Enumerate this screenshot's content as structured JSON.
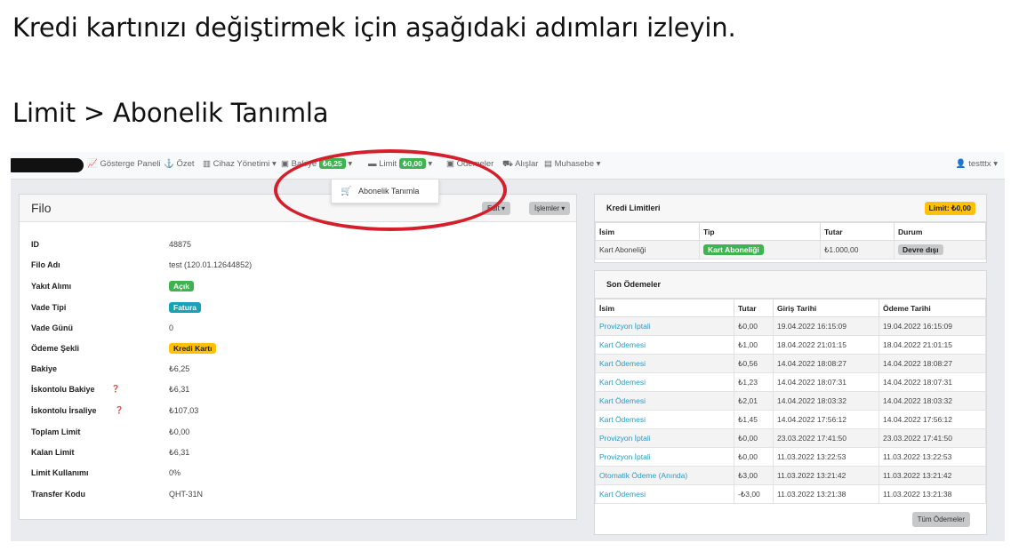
{
  "instructions": {
    "line1": "Kredi kartınızı değiştirmek için aşağıdaki adımları izleyin.",
    "line2": "Limit > Abonelik Tanımla"
  },
  "topbar": {
    "nav": {
      "gosterge": "Gösterge Paneli",
      "ozet": "Özet",
      "cihaz": "Cihaz Yönetimi",
      "bakiye": "Bakiye",
      "bakiye_badge": "₺6,25",
      "limit": "Limit",
      "limit_badge": "₺0,00",
      "odemeler": "Ödemeler",
      "alislar": "Alışlar",
      "muhasebe": "Muhasebe"
    },
    "user": "testttx"
  },
  "dropdown": {
    "item": "Abonelik Tanımla"
  },
  "filo": {
    "title": "Filo",
    "edit_button": "Edit",
    "islemler_button": "İşlemler",
    "rows": [
      {
        "label": "ID",
        "value": "48875"
      },
      {
        "label": "Filo Adı",
        "value": "test (120.01.12644852)"
      },
      {
        "label": "Yakıt Alımı",
        "value": "Açık"
      },
      {
        "label": "Vade Tipi",
        "value": "Fatura"
      },
      {
        "label": "Vade Günü",
        "value": "0"
      },
      {
        "label": "Ödeme Şekli",
        "value": "Kredi Kartı"
      },
      {
        "label": "Bakiye",
        "value": "₺6,25"
      },
      {
        "label": "İskontolu Bakiye",
        "value": "₺6,31"
      },
      {
        "label": "İskontolu İrsaliye",
        "value": "₺107,03"
      },
      {
        "label": "Toplam Limit",
        "value": "₺0,00"
      },
      {
        "label": "Kalan Limit",
        "value": "₺6,31"
      },
      {
        "label": "Limit Kullanımı",
        "value": "0%"
      },
      {
        "label": "Transfer Kodu",
        "value": "QHT-31N"
      }
    ]
  },
  "kredi": {
    "title": "Kredi Limitleri",
    "badge": "Limit: ₺0,00",
    "headers": [
      "İsim",
      "Tip",
      "Tutar",
      "Durum"
    ],
    "row": {
      "isim": "Kart Aboneliği",
      "tip": "Kart Aboneliği",
      "tutar": "₺1.000,00",
      "durum": "Devre dışı"
    }
  },
  "odemeler": {
    "title": "Son Ödemeler",
    "headers": [
      "İsim",
      "Tutar",
      "Giriş Tarihi",
      "Ödeme Tarihi"
    ],
    "rows": [
      [
        "Provizyon İptali",
        "₺0,00",
        "19.04.2022 16:15:09",
        "19.04.2022 16:15:09"
      ],
      [
        "Kart Ödemesi",
        "₺1,00",
        "18.04.2022 21:01:15",
        "18.04.2022 21:01:15"
      ],
      [
        "Kart Ödemesi",
        "₺0,56",
        "14.04.2022 18:08:27",
        "14.04.2022 18:08:27"
      ],
      [
        "Kart Ödemesi",
        "₺1,23",
        "14.04.2022 18:07:31",
        "14.04.2022 18:07:31"
      ],
      [
        "Kart Ödemesi",
        "₺2,01",
        "14.04.2022 18:03:32",
        "14.04.2022 18:03:32"
      ],
      [
        "Kart Ödemesi",
        "₺1,45",
        "14.04.2022 17:56:12",
        "14.04.2022 17:56:12"
      ],
      [
        "Provizyon İptali",
        "₺0,00",
        "23.03.2022 17:41:50",
        "23.03.2022 17:41:50"
      ],
      [
        "Provizyon İptali",
        "₺0,00",
        "11.03.2022 13:22:53",
        "11.03.2022 13:22:53"
      ],
      [
        "Otomatik Ödeme (Anında)",
        "₺3,00",
        "11.03.2022 13:21:42",
        "11.03.2022 13:21:42"
      ],
      [
        "Kart Ödemesi",
        "-₺3,00",
        "11.03.2022 13:21:38",
        "11.03.2022 13:21:38"
      ]
    ],
    "all_button": "Tüm Ödemeler"
  },
  "colors": {
    "accent_green": "#3fb34f",
    "link_blue": "#2a9bc2",
    "warning_yellow": "#ffc107",
    "highlight_red": "#d4202c"
  }
}
